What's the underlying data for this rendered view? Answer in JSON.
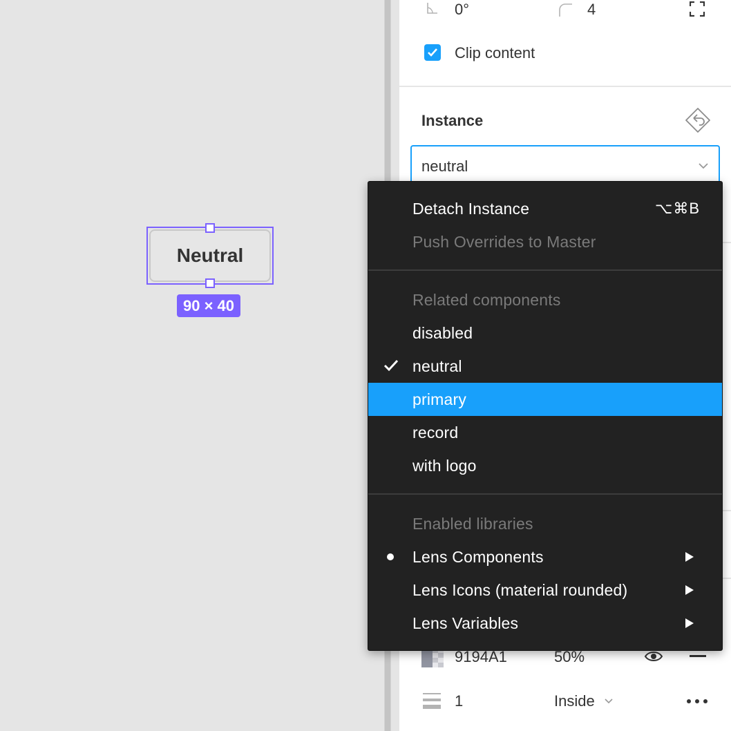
{
  "canvas": {
    "component_label": "Neutral",
    "size_badge": "90 × 40"
  },
  "panel": {
    "rotation_value": "0°",
    "corner_radius_value": "4",
    "clip_content_label": "Clip content",
    "clip_content_checked": true,
    "instance_heading": "Instance",
    "instance_selected": "neutral",
    "fill": {
      "hex": "9194A1",
      "opacity": "50%"
    },
    "stroke": {
      "weight": "1",
      "position": "Inside"
    },
    "accent_color": "#18a0fb"
  },
  "menu": {
    "detach": {
      "label": "Detach Instance",
      "shortcut": "⌥⌘B"
    },
    "push_overrides": {
      "label": "Push Overrides to Master"
    },
    "related_header": "Related components",
    "related": [
      {
        "label": "disabled"
      },
      {
        "label": "neutral",
        "checked": true
      },
      {
        "label": "primary",
        "highlighted": true
      },
      {
        "label": "record"
      },
      {
        "label": "with logo"
      }
    ],
    "libraries_header": "Enabled libraries",
    "libraries": [
      {
        "label": "Lens Components",
        "active": true
      },
      {
        "label": "Lens Icons (material rounded)"
      },
      {
        "label": "Lens Variables"
      }
    ],
    "highlight_color": "#18a0fb"
  },
  "selection_color": "#7b61ff"
}
